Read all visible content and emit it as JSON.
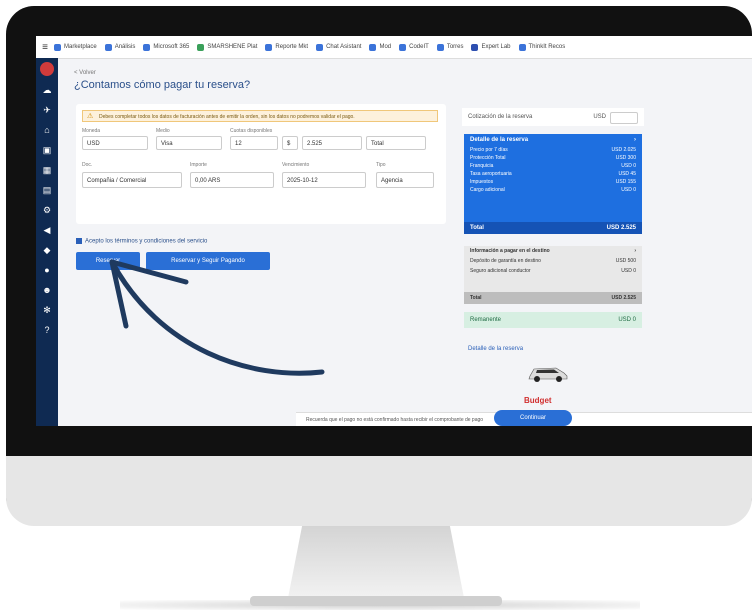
{
  "bookmarks": [
    "Marketplace",
    "Análisis",
    "Microsoft 365",
    "SMARSHENE Plat",
    "Reporte Mkt",
    "Chat Asistant",
    "Mod",
    "CodeIT",
    "Torres",
    "Expert Lab",
    "ThinkIt Recos"
  ],
  "breadcrumb": "< Volver",
  "page_title": "¿Contamos cómo pagar tu reserva?",
  "warning": "Debes completar todos los datos de facturación antes de emitir la orden, sin los datos no podremos validar el pago.",
  "form": {
    "labels": [
      "Moneda",
      "Medio",
      "Cuotas disponibles",
      "Doc.",
      "Importe",
      "Vencimiento",
      "Tipo"
    ],
    "row1": [
      "USD",
      "Visa",
      "12",
      "$",
      "2.525",
      "Total"
    ],
    "row2": [
      "Compañia / Comercial",
      "0,00 ARS",
      "2025-10-12",
      "Agencia"
    ],
    "checkbox_label": "Acepto los términos y condiciones del servicio"
  },
  "buttons": {
    "primary": "Reservar",
    "secondary": "Reservar y Seguir Pagando"
  },
  "panel": {
    "top_label": "Cotización de la reserva",
    "currency": "USD",
    "summary_title": "Detalle de la reserva",
    "summary_rows": [
      {
        "label": "Precio por 7 días",
        "value": "USD 2.025"
      },
      {
        "label": "Protección Total",
        "value": "USD 300"
      },
      {
        "label": "Franquicia",
        "value": "USD 0"
      },
      {
        "label": "Tasa aeroportuaria",
        "value": "USD 45"
      },
      {
        "label": "Impuestos",
        "value": "USD 155"
      },
      {
        "label": "Cargo adicional",
        "value": "USD 0"
      }
    ],
    "summary_total_label": "Total",
    "summary_total_value": "USD 2.525",
    "pay_title": "Información a pagar en el destino",
    "pay_rows": [
      {
        "label": "Depósito de garantía en destino",
        "value": "USD 500"
      },
      {
        "label": "Seguro adicional conductor",
        "value": "USD 0"
      }
    ],
    "pay_total_label": "Total",
    "pay_total_value": "USD 2.525",
    "remain_label": "Remanente",
    "remain_value": "USD 0",
    "detail_link": "Detalle de la reserva",
    "brand": "Budget"
  },
  "bottom_bar": "Recuerda que el pago no está confirmado hasta recibir el comprobante de pago",
  "cta": "Continuar"
}
